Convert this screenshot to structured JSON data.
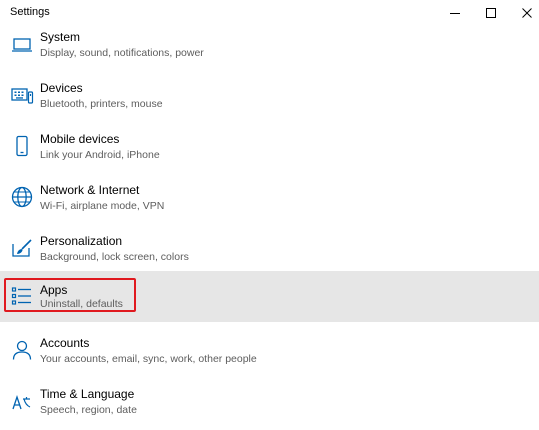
{
  "window": {
    "title": "Settings",
    "minimize_icon": "minimize-icon",
    "maximize_icon": "maximize-icon",
    "close_icon": "close-icon"
  },
  "colors": {
    "accent": "#0063b1",
    "selected_background": "#e6e6e6",
    "highlight_border": "#e0191f",
    "description_text": "#5d5d5d"
  },
  "items": [
    {
      "label": "System",
      "description": "Display, sound, notifications, power",
      "icon": "laptop-icon"
    },
    {
      "label": "Devices",
      "description": "Bluetooth, printers, mouse",
      "icon": "keyboard-icon"
    },
    {
      "label": "Mobile devices",
      "description": "Link your Android, iPhone",
      "icon": "phone-icon"
    },
    {
      "label": "Network & Internet",
      "description": "Wi-Fi, airplane mode, VPN",
      "icon": "globe-icon"
    },
    {
      "label": "Personalization",
      "description": "Background, lock screen, colors",
      "icon": "paint-brush-icon"
    },
    {
      "label": "Apps",
      "description": "Uninstall, defaults",
      "icon": "apps-list-icon",
      "selected": true
    },
    {
      "label": "Accounts",
      "description": "Your accounts, email, sync, work, other people",
      "icon": "person-icon"
    },
    {
      "label": "Time & Language",
      "description": "Speech, region, date",
      "icon": "time-language-icon"
    }
  ]
}
